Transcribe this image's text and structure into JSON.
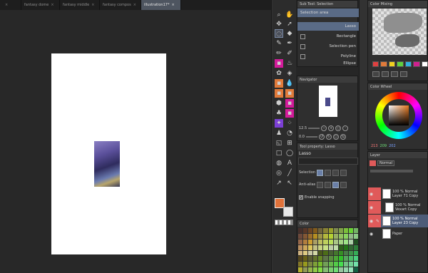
{
  "tabs": [
    {
      "label": "",
      "active": false
    },
    {
      "label": "fantasy dome",
      "active": false
    },
    {
      "label": "fantasy middle",
      "active": false
    },
    {
      "label": "fantasy compos",
      "active": false
    },
    {
      "label": "illustration17*",
      "active": true
    }
  ],
  "tab_close": "×",
  "subtool": {
    "title": "Sub Tool: Selection",
    "group": "Selection area",
    "items": [
      {
        "label": "Lasso",
        "selected": true
      },
      {
        "label": "Rectangle",
        "selected": false
      },
      {
        "label": "Selection pen",
        "selected": false
      },
      {
        "label": "Polyline",
        "selected": false
      },
      {
        "label": "Ellipse",
        "selected": false
      }
    ]
  },
  "navigator": {
    "title": "Navigator",
    "zoom": "12.5",
    "rotation": "0.0"
  },
  "tool_property": {
    "title": "Tool property: Lasso",
    "tool_name": "Lasso",
    "selection_label": "Selection",
    "antialias_label": "Anti-alias",
    "snapping_label": "Enable snapping",
    "snapping_checked": true
  },
  "color_set": {
    "title": "Color"
  },
  "color_mixing": {
    "title": "Color Mixing",
    "chips": [
      "#e04040",
      "#e07a3a",
      "#f0d020",
      "#60d040",
      "#30b0e0",
      "#d02090",
      "#ffffff"
    ]
  },
  "color_wheel": {
    "title": "Color Wheel",
    "r": "213",
    "g": "209",
    "b": "202"
  },
  "layers": {
    "title": "Layer",
    "blend": "Normal",
    "items": [
      {
        "opacity": "100 %",
        "blend": "Normal",
        "name": "Layer 71 Copy",
        "selected": false,
        "visible": true,
        "red": true
      },
      {
        "opacity": "100 %",
        "blend": "Normal",
        "name": "Vexart Copy",
        "selected": false,
        "visible": true,
        "red": true
      },
      {
        "opacity": "100 %",
        "blend": "Normal",
        "name": "Layer 23 Copy",
        "selected": true,
        "visible": true,
        "red": true
      },
      {
        "opacity": "",
        "blend": "",
        "name": "Paper",
        "selected": false,
        "visible": true,
        "red": false
      }
    ]
  },
  "colors": {
    "main": "#e0723a",
    "sub": "#e8e8e8",
    "accent": "#5a6b86"
  }
}
